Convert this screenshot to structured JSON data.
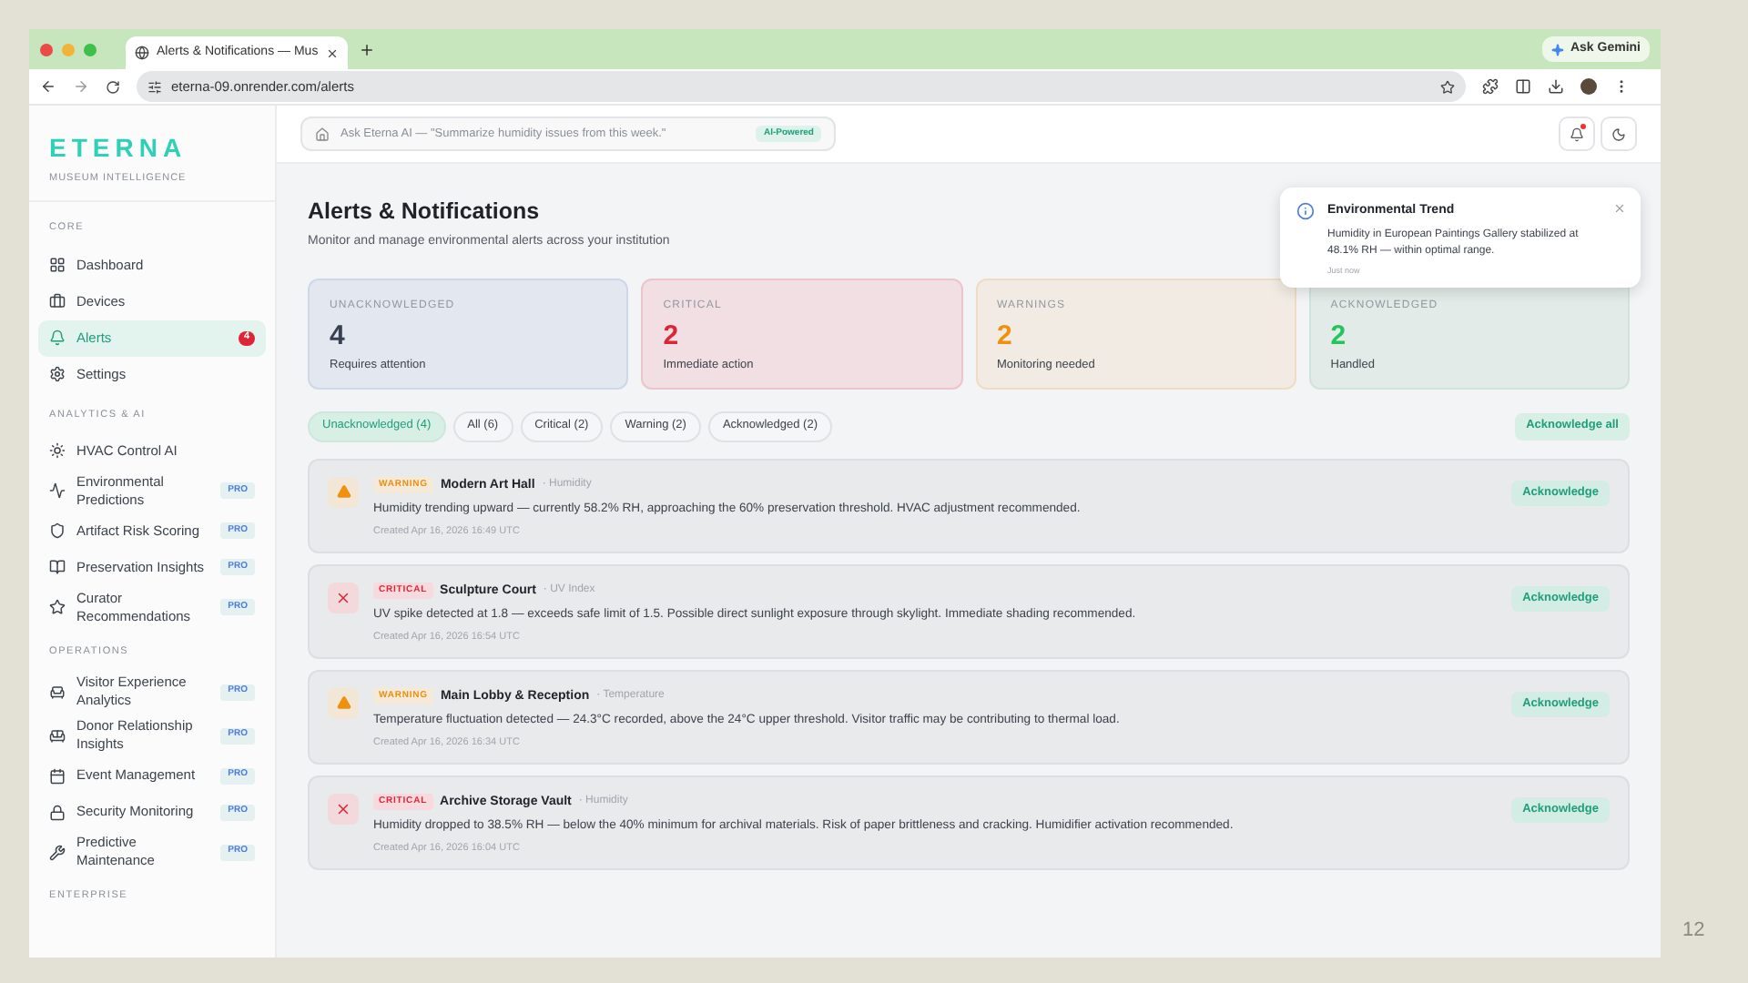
{
  "browser": {
    "tab_title": "Alerts & Notifications — Mus",
    "gemini": "Ask Gemini",
    "url": "eterna-09.onrender.com/alerts"
  },
  "brand": {
    "name": "ETERNA",
    "tagline": "MUSEUM INTELLIGENCE"
  },
  "sidebar": {
    "sections": [
      {
        "title": "CORE",
        "items": [
          {
            "label": "Dashboard",
            "selected": false
          },
          {
            "label": "Devices",
            "selected": false
          },
          {
            "label": "Alerts",
            "selected": true,
            "badge": "4"
          },
          {
            "label": "Settings",
            "selected": false
          }
        ]
      },
      {
        "title": "ANALYTICS & AI",
        "items": [
          {
            "label": "HVAC Control AI",
            "selected": false
          },
          {
            "label": "Environmental Predictions",
            "selected": false,
            "tag": "PRO"
          },
          {
            "label": "Artifact Risk Scoring",
            "selected": false,
            "tag": "PRO"
          },
          {
            "label": "Preservation Insights",
            "selected": false,
            "tag": "PRO"
          },
          {
            "label": "Curator Recommendations",
            "selected": false,
            "tag": "PRO"
          }
        ]
      },
      {
        "title": "OPERATIONS",
        "items": [
          {
            "label": "Visitor Experience Analytics",
            "selected": false,
            "tag": "PRO"
          },
          {
            "label": "Donor Relationship Insights",
            "selected": false,
            "tag": "PRO"
          },
          {
            "label": "Event Management",
            "selected": false,
            "tag": "PRO"
          },
          {
            "label": "Security Monitoring",
            "selected": false,
            "tag": "PRO"
          },
          {
            "label": "Predictive Maintenance",
            "selected": false,
            "tag": "PRO"
          }
        ]
      },
      {
        "title": "ENTERPRISE"
      }
    ]
  },
  "search": {
    "placeholder": "Ask Eterna AI — \"Summarize humidity issues from this week.\"",
    "badge": "AI-Powered"
  },
  "header": {
    "unread": true
  },
  "page": {
    "title": "Alerts & Notifications",
    "subtitle": "Monitor and manage environmental alerts across your institution"
  },
  "stats": [
    {
      "kind": "neutral",
      "label": "UNACKNOWLEDGED",
      "value": "4",
      "caption": "Requires attention"
    },
    {
      "kind": "critical",
      "label": "CRITICAL",
      "value": "2",
      "caption": "Immediate action"
    },
    {
      "kind": "warning",
      "label": "WARNINGS",
      "value": "2",
      "caption": "Monitoring needed"
    },
    {
      "kind": "success",
      "label": "ACKNOWLEDGED",
      "value": "2",
      "caption": "Handled"
    }
  ],
  "filters": [
    {
      "label": "Unacknowledged (4)",
      "selected": true
    },
    {
      "label": "All (6)",
      "selected": false
    },
    {
      "label": "Critical (2)",
      "selected": false
    },
    {
      "label": "Warning (2)",
      "selected": false
    },
    {
      "label": "Acknowledged (2)",
      "selected": false
    }
  ],
  "acknowledge_all": "Acknowledge all",
  "alerts": [
    {
      "kind": "warning",
      "severity": "WARNING",
      "location": "Modern Art Hall",
      "sensor": "· Humidity",
      "message": "Humidity trending upward — currently 58.2% RH, approaching the 60% preservation threshold. HVAC adjustment recommended.",
      "created": "Created Apr 16, 2026 16:49 UTC",
      "action": "Acknowledge"
    },
    {
      "kind": "critical",
      "severity": "CRITICAL",
      "location": "Sculpture Court",
      "sensor": "· UV Index",
      "message": "UV spike detected at 1.8 — exceeds safe limit of 1.5. Possible direct sunlight exposure through skylight. Immediate shading recommended.",
      "created": "Created Apr 16, 2026 16:54 UTC",
      "action": "Acknowledge"
    },
    {
      "kind": "warning",
      "severity": "WARNING",
      "location": "Main Lobby & Reception",
      "sensor": "· Temperature",
      "message": "Temperature fluctuation detected — 24.3°C recorded, above the 24°C upper threshold. Visitor traffic may be contributing to thermal load.",
      "created": "Created Apr 16, 2026 16:34 UTC",
      "action": "Acknowledge"
    },
    {
      "kind": "critical",
      "severity": "CRITICAL",
      "location": "Archive Storage Vault",
      "sensor": "· Humidity",
      "message": "Humidity dropped to 38.5% RH — below the 40% minimum for archival materials. Risk of paper brittleness and cracking. Humidifier activation recommended.",
      "created": "Created Apr 16, 2026 16:04 UTC",
      "action": "Acknowledge"
    }
  ],
  "toast": {
    "title": "Environmental Trend",
    "message": "Humidity in European Paintings Gallery stabilized at 48.1% RH — within optimal range.",
    "time": "Just now"
  },
  "slide_number": "12"
}
